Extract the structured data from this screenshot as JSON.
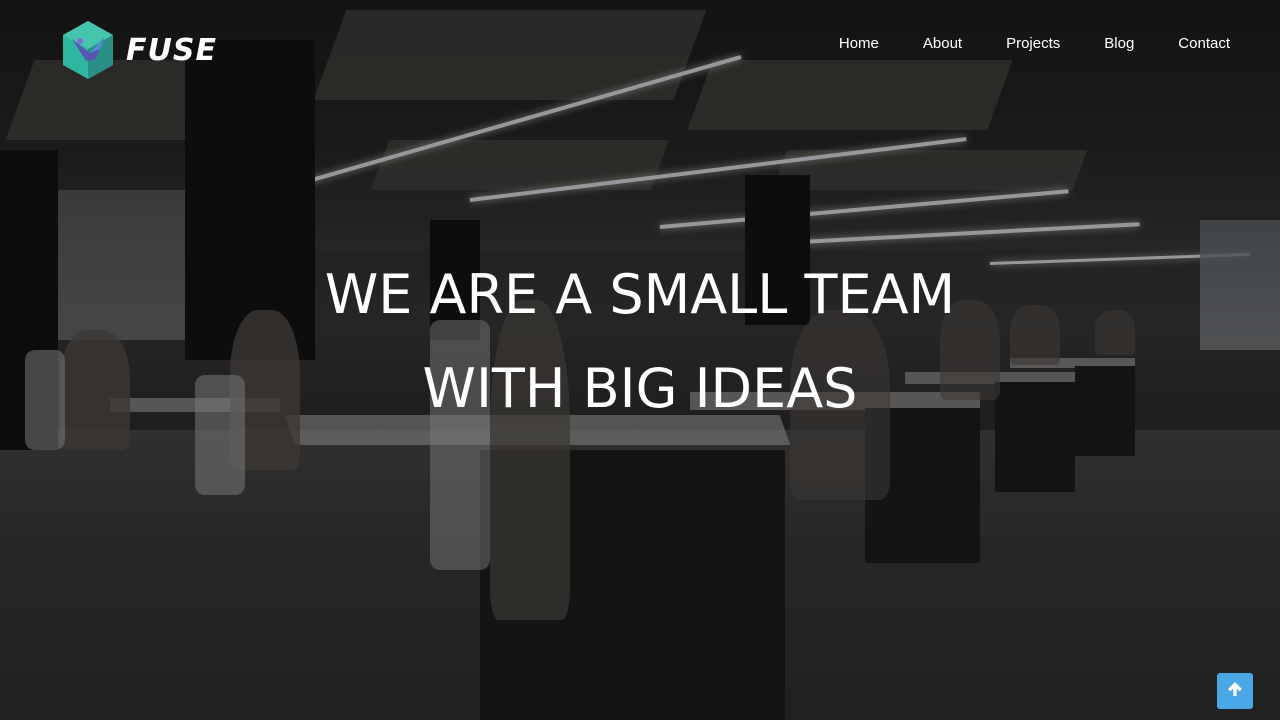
{
  "brand": {
    "name": "FUSE",
    "accent_colors": [
      "#2fb6a0",
      "#5b4fb3",
      "#4b8ed6"
    ]
  },
  "nav": {
    "items": [
      {
        "label": "Home"
      },
      {
        "label": "About"
      },
      {
        "label": "Projects"
      },
      {
        "label": "Blog"
      },
      {
        "label": "Contact"
      }
    ]
  },
  "hero": {
    "headline_line1": "WE ARE A SMALL TEAM",
    "headline_line2": "WITH BIG IDEAS",
    "background": "open-plan office photo"
  },
  "scroll_top": {
    "icon": "arrow-up-icon",
    "color": "#4aa8e6"
  }
}
